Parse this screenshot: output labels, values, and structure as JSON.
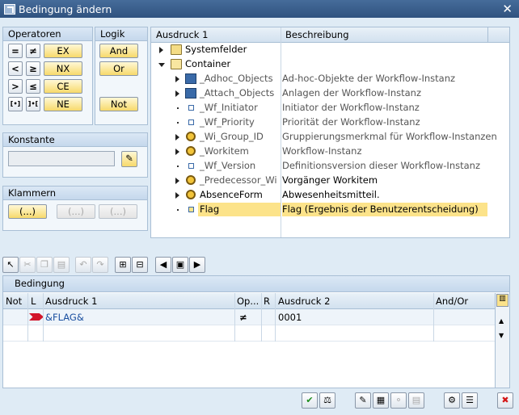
{
  "window": {
    "title": "Bedingung ändern"
  },
  "operators": {
    "header": "Operatoren",
    "eq": "=",
    "ne_sym": "≠",
    "ex": "EX",
    "lt": "<",
    "ge": "≥",
    "nx": "NX",
    "gt": ">",
    "le": "≤",
    "ce": "CE",
    "in": "[•]",
    "notin": "]•[",
    "ne": "NE"
  },
  "logic": {
    "header": "Logik",
    "and": "And",
    "or": "Or",
    "not": "Not"
  },
  "constant": {
    "header": "Konstante",
    "value": ""
  },
  "brackets": {
    "header": "Klammern",
    "open": "(...)",
    "b2": "(...)",
    "b3": "(...)"
  },
  "tree": {
    "col1": "Ausdruck 1",
    "col2": "Beschreibung",
    "rows": [
      {
        "name": "Systemfelder",
        "desc": ""
      },
      {
        "name": "Container",
        "desc": ""
      },
      {
        "name": "_Adhoc_Objects",
        "desc": "Ad-hoc-Objekte der Workflow-Instanz"
      },
      {
        "name": "_Attach_Objects",
        "desc": "Anlagen der Workflow-Instanz"
      },
      {
        "name": "_Wf_Initiator",
        "desc": "Initiator der Workflow-Instanz"
      },
      {
        "name": "_Wf_Priority",
        "desc": "Priorität der Workflow-Instanz"
      },
      {
        "name": "_Wi_Group_ID",
        "desc": "Gruppierungsmerkmal für Workflow-Instanzen"
      },
      {
        "name": "_Workitem",
        "desc": "Workflow-Instanz"
      },
      {
        "name": "_Wf_Version",
        "desc": "Definitionsversion dieser Workflow-Instanz"
      },
      {
        "name": "_Predecessor_Wi",
        "desc": "Vorgänger Workitem"
      },
      {
        "name": "AbsenceForm",
        "desc": "Abwesenheitsmitteil."
      },
      {
        "name": "Flag",
        "desc": "Flag (Ergebnis der Benutzerentscheidung)"
      }
    ]
  },
  "grid": {
    "title": "Bedingung",
    "cols": {
      "not": "Not",
      "l": "L",
      "expr1": "Ausdruck 1",
      "op": "Op...",
      "r": "R",
      "expr2": "Ausdruck 2",
      "andor": "And/Or"
    },
    "rows": [
      {
        "expr1": "&FLAG&",
        "op": "≠",
        "expr2": "0001"
      }
    ]
  },
  "colors": {
    "title_bg": "#2f527f",
    "selected": "#fce38a",
    "link": "#1a4fa0"
  }
}
